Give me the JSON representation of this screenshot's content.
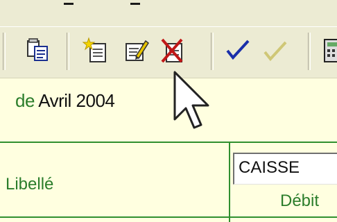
{
  "toolbar": {
    "icons": [
      "paste-icon",
      "new-record-icon",
      "edit-record-icon",
      "delete-record-icon",
      "validate-icon",
      "validate-disabled-icon",
      "calculator-icon"
    ]
  },
  "header": {
    "period_prefix": "de",
    "period_value": "Avril 2004"
  },
  "grid": {
    "label_header": "Libellé",
    "account_value": "CAISSE",
    "column_header": "Débit"
  },
  "colors": {
    "background": "#ECEBD3",
    "panel": "#FFFFE0",
    "accent_green": "#2f8f2f"
  }
}
